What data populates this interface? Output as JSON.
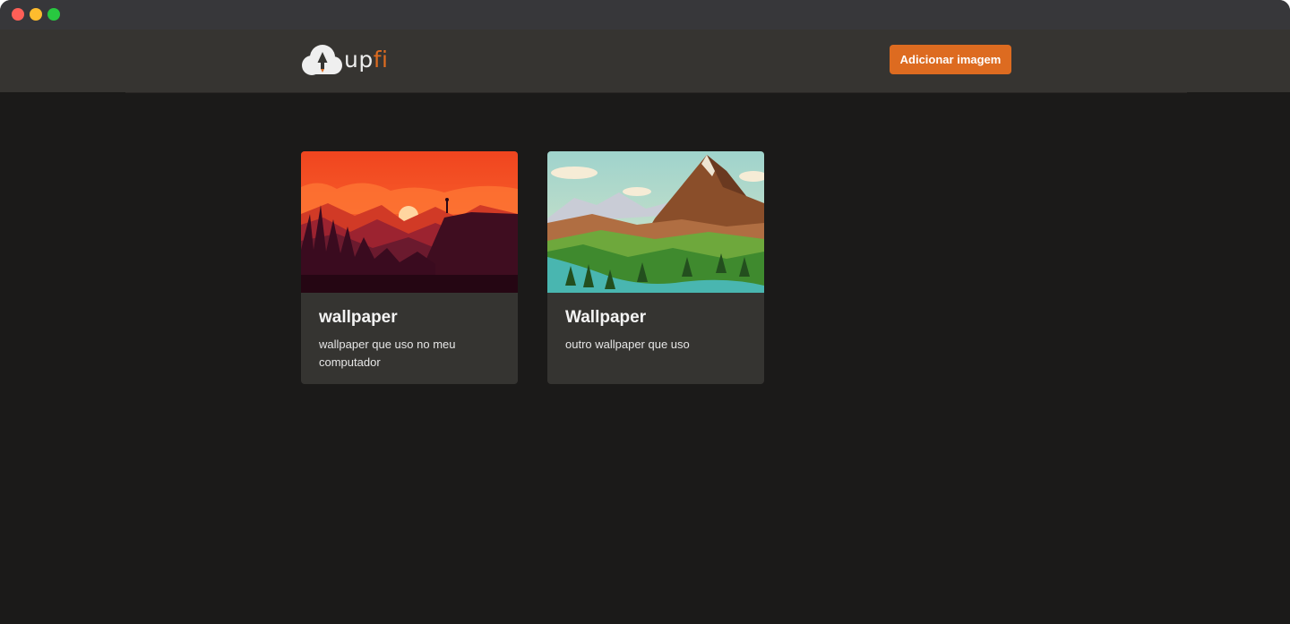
{
  "window": {
    "controls": {
      "close_color": "#fe5f57",
      "minimize_color": "#febc2e",
      "maximize_color": "#28c840"
    }
  },
  "header": {
    "logo": {
      "icon": "cloud-upload-icon",
      "text_part1": "up",
      "text_part2": "fi"
    },
    "add_button_label": "Adicionar imagem"
  },
  "colors": {
    "accent": "#dd6b20",
    "background": "#1b1a19",
    "header": "#363431",
    "card": "#353431"
  },
  "cards": [
    {
      "title": "wallpaper",
      "description": "wallpaper que uso no meu computador",
      "image": "sunset-forest-landscape-illustration"
    },
    {
      "title": "Wallpaper",
      "description": "outro wallpaper que uso",
      "image": "low-poly-mountain-landscape-illustration"
    }
  ]
}
